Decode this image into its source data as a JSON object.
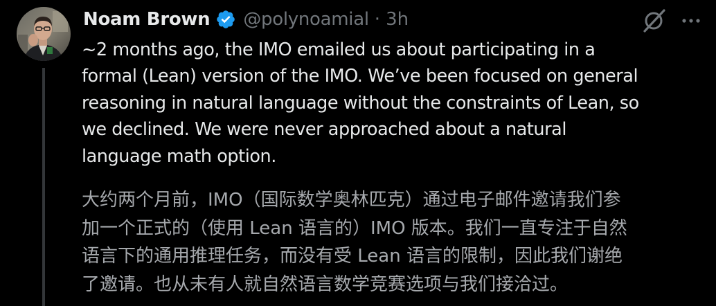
{
  "author": {
    "display_name": "Noam Brown",
    "handle": "@polynoamial",
    "separator": "·",
    "time": "3h",
    "verified": true,
    "verified_color": "#1d9bf0"
  },
  "tweet": {
    "text_en": "~2 months ago, the IMO emailed us about participating in a\nformal (Lean) version of the IMO. We’ve been focused on general\nreasoning in natural language without the constraints of Lean, so\nwe declined. We were never approached about a natural\nlanguage math option.",
    "text_zh": "大约两个月前，IMO（国际数学奥林匹克）通过电子邮件邀请我们参\n加一个正式的（使用 Lean 语言的）IMO 版本。我们一直专注于自然\n语言下的通用推理任务，而没有受 Lean 语言的限制，因此我们谢绝\n了邀请。也从未有人就自然语言数学竞赛选项与我们接洽过。"
  },
  "icons": {
    "avatar": "user-photo",
    "verified": "verified-badge-icon",
    "grok": "grok-icon",
    "more": "more-horizontal-icon"
  },
  "colors": {
    "background": "#000000",
    "primary_text": "#e7e9ea",
    "secondary_text": "#71767b",
    "translation_text": "#a6a9ad",
    "thread_line": "#333639"
  }
}
